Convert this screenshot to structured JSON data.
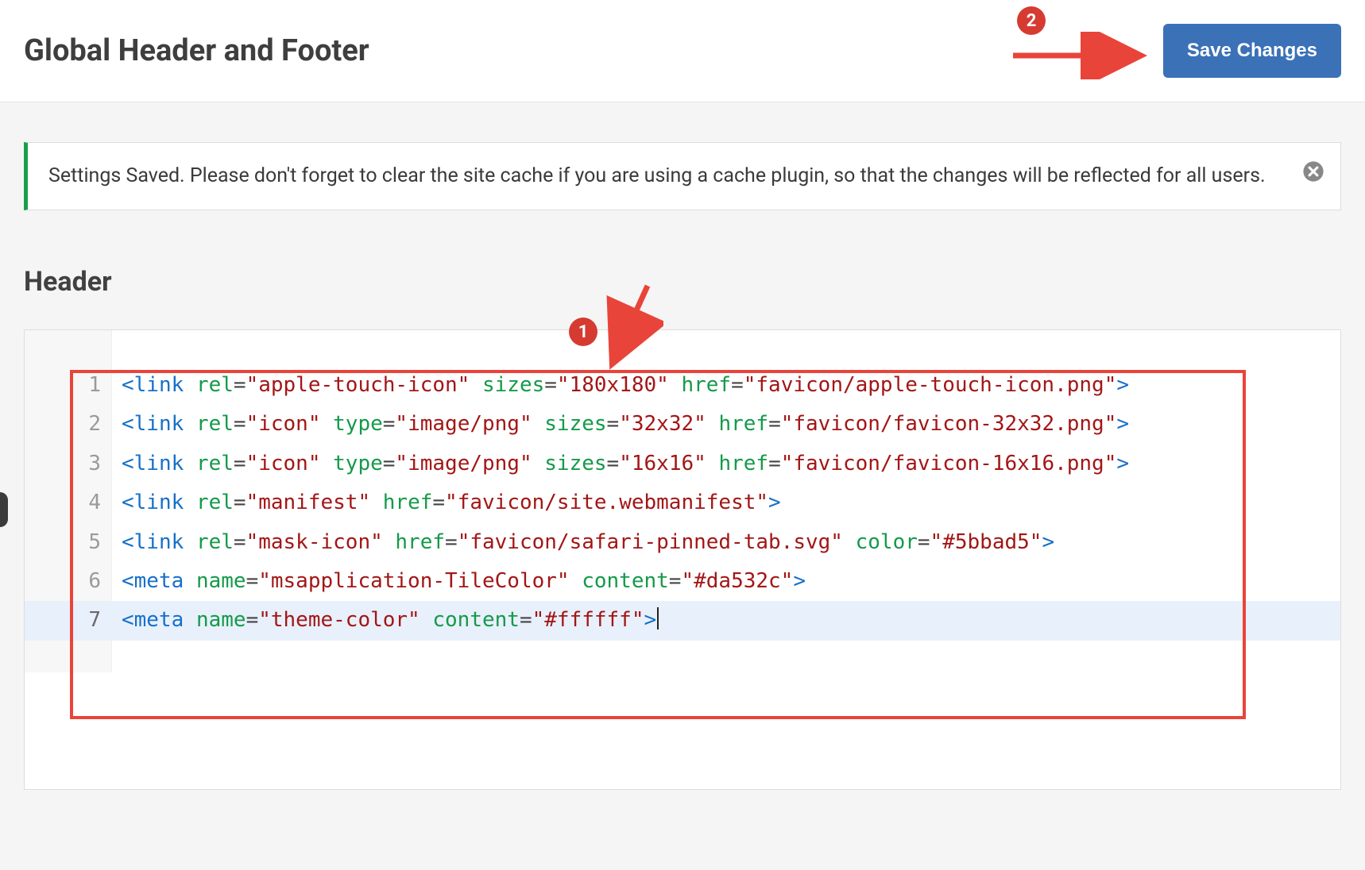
{
  "header": {
    "title": "Global Header and Footer",
    "save_label": "Save Changes"
  },
  "notice": {
    "text": "Settings Saved. Please don't forget to clear the site cache if you are using a cache plugin, so that the changes will be reflected for all users."
  },
  "section": {
    "header_title": "Header"
  },
  "annotations": {
    "badge1": "1",
    "badge2": "2"
  },
  "code": {
    "active_line_index": 6,
    "lines": [
      {
        "n": "1",
        "tokens": [
          {
            "t": "bracket",
            "v": "<"
          },
          {
            "t": "tagname",
            "v": "link"
          },
          {
            "t": "plain",
            "v": " "
          },
          {
            "t": "attrname",
            "v": "rel"
          },
          {
            "t": "eq",
            "v": "="
          },
          {
            "t": "string",
            "v": "\"apple-touch-icon\""
          },
          {
            "t": "plain",
            "v": " "
          },
          {
            "t": "attrname",
            "v": "sizes"
          },
          {
            "t": "eq",
            "v": "="
          },
          {
            "t": "string",
            "v": "\"180x180\""
          },
          {
            "t": "plain",
            "v": " "
          },
          {
            "t": "attrname",
            "v": "href"
          },
          {
            "t": "eq",
            "v": "="
          },
          {
            "t": "string",
            "v": "\"favicon/apple-touch-icon.png\""
          },
          {
            "t": "bracket",
            "v": ">"
          }
        ]
      },
      {
        "n": "2",
        "tokens": [
          {
            "t": "bracket",
            "v": "<"
          },
          {
            "t": "tagname",
            "v": "link"
          },
          {
            "t": "plain",
            "v": " "
          },
          {
            "t": "attrname",
            "v": "rel"
          },
          {
            "t": "eq",
            "v": "="
          },
          {
            "t": "string",
            "v": "\"icon\""
          },
          {
            "t": "plain",
            "v": " "
          },
          {
            "t": "attrname",
            "v": "type"
          },
          {
            "t": "eq",
            "v": "="
          },
          {
            "t": "string",
            "v": "\"image/png\""
          },
          {
            "t": "plain",
            "v": " "
          },
          {
            "t": "attrname",
            "v": "sizes"
          },
          {
            "t": "eq",
            "v": "="
          },
          {
            "t": "string",
            "v": "\"32x32\""
          },
          {
            "t": "plain",
            "v": " "
          },
          {
            "t": "attrname",
            "v": "href"
          },
          {
            "t": "eq",
            "v": "="
          },
          {
            "t": "string",
            "v": "\"favicon/favicon-32x32.png\""
          },
          {
            "t": "bracket",
            "v": ">"
          }
        ]
      },
      {
        "n": "3",
        "tokens": [
          {
            "t": "bracket",
            "v": "<"
          },
          {
            "t": "tagname",
            "v": "link"
          },
          {
            "t": "plain",
            "v": " "
          },
          {
            "t": "attrname",
            "v": "rel"
          },
          {
            "t": "eq",
            "v": "="
          },
          {
            "t": "string",
            "v": "\"icon\""
          },
          {
            "t": "plain",
            "v": " "
          },
          {
            "t": "attrname",
            "v": "type"
          },
          {
            "t": "eq",
            "v": "="
          },
          {
            "t": "string",
            "v": "\"image/png\""
          },
          {
            "t": "plain",
            "v": " "
          },
          {
            "t": "attrname",
            "v": "sizes"
          },
          {
            "t": "eq",
            "v": "="
          },
          {
            "t": "string",
            "v": "\"16x16\""
          },
          {
            "t": "plain",
            "v": " "
          },
          {
            "t": "attrname",
            "v": "href"
          },
          {
            "t": "eq",
            "v": "="
          },
          {
            "t": "string",
            "v": "\"favicon/favicon-16x16.png\""
          },
          {
            "t": "bracket",
            "v": ">"
          }
        ]
      },
      {
        "n": "4",
        "tokens": [
          {
            "t": "bracket",
            "v": "<"
          },
          {
            "t": "tagname",
            "v": "link"
          },
          {
            "t": "plain",
            "v": " "
          },
          {
            "t": "attrname",
            "v": "rel"
          },
          {
            "t": "eq",
            "v": "="
          },
          {
            "t": "string",
            "v": "\"manifest\""
          },
          {
            "t": "plain",
            "v": " "
          },
          {
            "t": "attrname",
            "v": "href"
          },
          {
            "t": "eq",
            "v": "="
          },
          {
            "t": "string",
            "v": "\"favicon/site.webmanifest\""
          },
          {
            "t": "bracket",
            "v": ">"
          }
        ]
      },
      {
        "n": "5",
        "tokens": [
          {
            "t": "bracket",
            "v": "<"
          },
          {
            "t": "tagname",
            "v": "link"
          },
          {
            "t": "plain",
            "v": " "
          },
          {
            "t": "attrname",
            "v": "rel"
          },
          {
            "t": "eq",
            "v": "="
          },
          {
            "t": "string",
            "v": "\"mask-icon\""
          },
          {
            "t": "plain",
            "v": " "
          },
          {
            "t": "attrname",
            "v": "href"
          },
          {
            "t": "eq",
            "v": "="
          },
          {
            "t": "string",
            "v": "\"favicon/safari-pinned-tab.svg\""
          },
          {
            "t": "plain",
            "v": " "
          },
          {
            "t": "attrname",
            "v": "color"
          },
          {
            "t": "eq",
            "v": "="
          },
          {
            "t": "string",
            "v": "\"#5bbad5\""
          },
          {
            "t": "bracket",
            "v": ">"
          }
        ]
      },
      {
        "n": "6",
        "tokens": [
          {
            "t": "bracket",
            "v": "<"
          },
          {
            "t": "tagname",
            "v": "meta"
          },
          {
            "t": "plain",
            "v": " "
          },
          {
            "t": "attrname",
            "v": "name"
          },
          {
            "t": "eq",
            "v": "="
          },
          {
            "t": "string",
            "v": "\"msapplication-TileColor\""
          },
          {
            "t": "plain",
            "v": " "
          },
          {
            "t": "attrname",
            "v": "content"
          },
          {
            "t": "eq",
            "v": "="
          },
          {
            "t": "string",
            "v": "\"#da532c\""
          },
          {
            "t": "bracket",
            "v": ">"
          }
        ]
      },
      {
        "n": "7",
        "tokens": [
          {
            "t": "bracket",
            "v": "<"
          },
          {
            "t": "tagname",
            "v": "meta"
          },
          {
            "t": "plain",
            "v": " "
          },
          {
            "t": "attrname",
            "v": "name"
          },
          {
            "t": "eq",
            "v": "="
          },
          {
            "t": "string",
            "v": "\"theme-color\""
          },
          {
            "t": "plain",
            "v": " "
          },
          {
            "t": "attrname",
            "v": "content"
          },
          {
            "t": "eq",
            "v": "="
          },
          {
            "t": "string",
            "v": "\"#ffffff\""
          },
          {
            "t": "bracket",
            "v": ">"
          }
        ]
      }
    ]
  }
}
